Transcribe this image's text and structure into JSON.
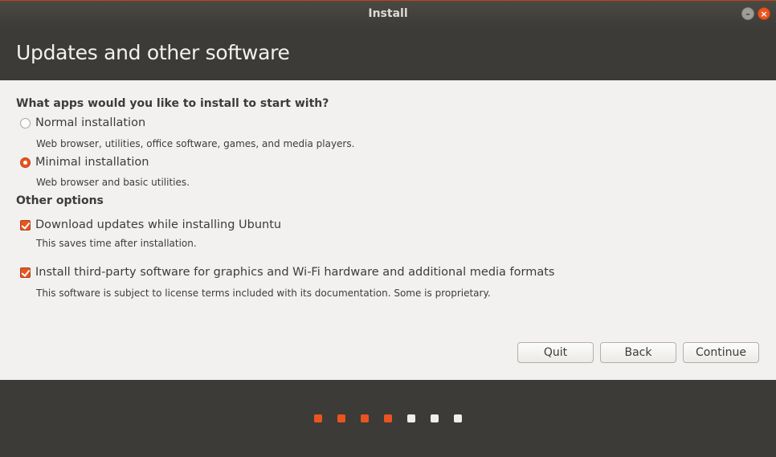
{
  "window": {
    "title": "Install"
  },
  "header": {
    "title": "Updates and other software"
  },
  "apps_section": {
    "heading": "What apps would you like to install to start with?",
    "options": [
      {
        "label": "Normal installation",
        "description": "Web browser, utilities, office software, games, and media players.",
        "selected": false
      },
      {
        "label": "Minimal installation",
        "description": "Web browser and basic utilities.",
        "selected": true
      }
    ]
  },
  "other_section": {
    "heading": "Other options",
    "options": [
      {
        "label": "Download updates while installing Ubuntu",
        "description": "This saves time after installation.",
        "checked": true
      },
      {
        "label": "Install third-party software for graphics and Wi-Fi hardware and additional media formats",
        "description": "This software is subject to license terms included with its documentation. Some is proprietary.",
        "checked": true
      }
    ]
  },
  "buttons": {
    "quit": "Quit",
    "back": "Back",
    "continue": "Continue"
  },
  "progress": {
    "total_steps": 7,
    "completed_steps": 4
  },
  "colors": {
    "accent": "#e95420",
    "dark_bg": "#3c3b37",
    "content_bg": "#f2f1f0"
  }
}
